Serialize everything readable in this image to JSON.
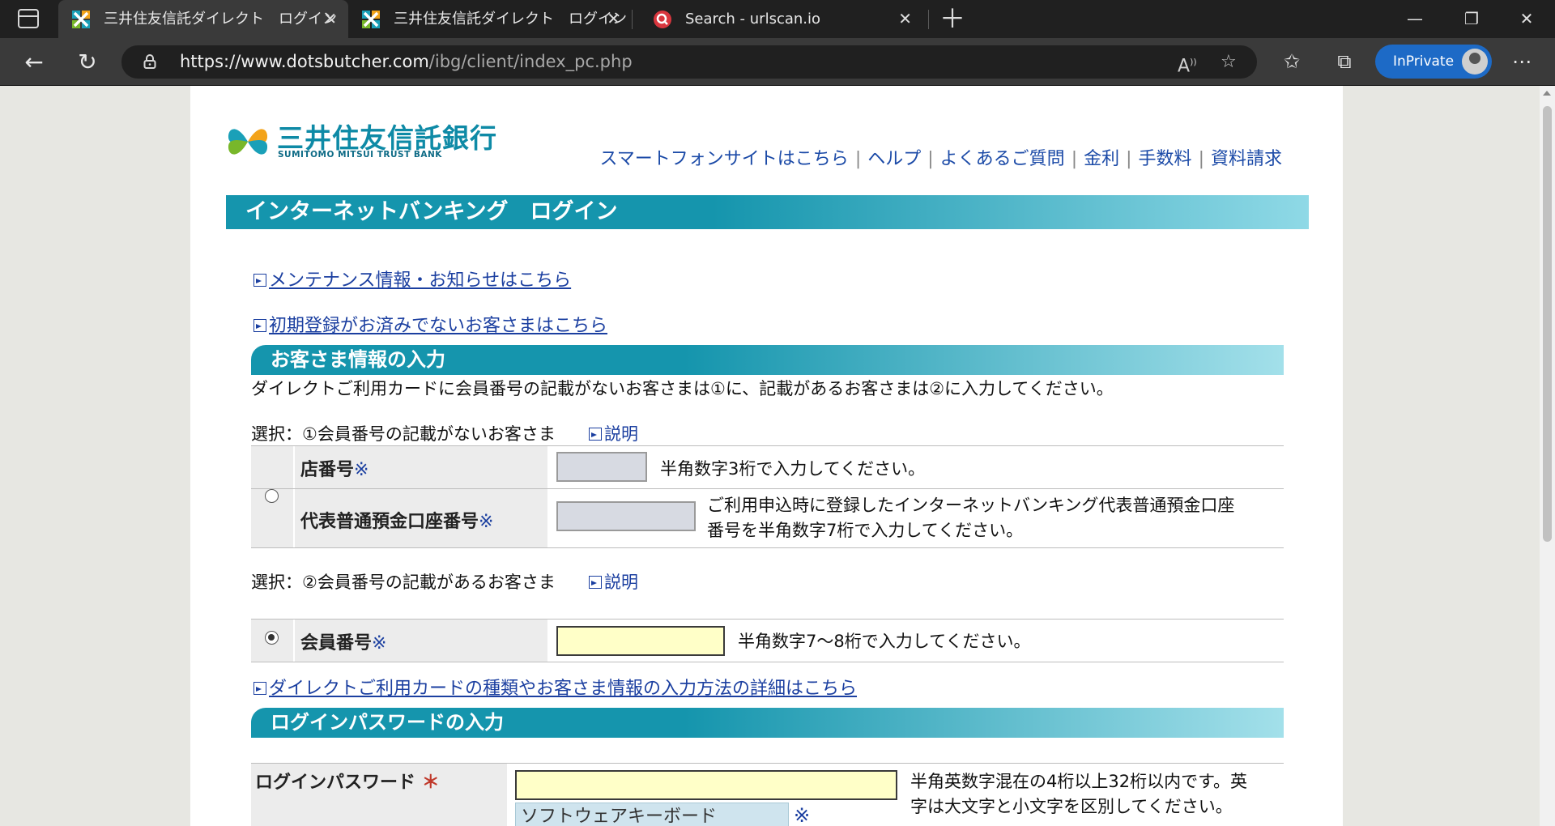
{
  "browser": {
    "tabs": [
      {
        "title": "三井住友信託ダイレクト　ログイン",
        "active": true
      },
      {
        "title": "三井住友信託ダイレクト　ログイン",
        "active": false
      },
      {
        "title": "Search - urlscan.io",
        "active": false
      }
    ],
    "url_host": "https://www.dotsbutcher.com",
    "url_path": "/ibg/client/index_pc.php",
    "inprivate_label": "InPrivate"
  },
  "header": {
    "logo_jp": "三井住友信託銀行",
    "logo_en": "SUMITOMO MITSUI TRUST BANK",
    "links": [
      "スマートフォンサイトはこちら",
      "ヘルプ",
      "よくあるご質問",
      "金利",
      "手数料",
      "資料請求"
    ]
  },
  "page_title": "インターネットバンキング　ログイン",
  "notices": {
    "maintenance": "メンテナンス情報・お知らせはこちら",
    "first_registration": "初期登録がお済みでないお客さまはこちら"
  },
  "customer_info": {
    "section_title": "お客さま情報の入力",
    "instruction": "ダイレクトご利用カードに会員番号の記載がないお客さまは①に、記載があるお客さまは②に入力してください。",
    "option1": {
      "label": "選択：①会員番号の記載がないお客さま",
      "help": "説明",
      "branch_label": "店番号",
      "branch_hint": "半角数字3桁で入力してください。",
      "account_label": "代表普通預金口座番号",
      "account_hint_1": "ご利用申込時に登録したインターネットバンキング代表普通預金口座",
      "account_hint_2": "番号を半角数字7桁で入力してください。"
    },
    "option2": {
      "label": "選択：②会員番号の記載があるお客さま",
      "help": "説明",
      "member_label": "会員番号",
      "member_hint": "半角数字7～8桁で入力してください。"
    },
    "required_mark": "※",
    "details_link": "ダイレクトご利用カードの種類やお客さま情報の入力方法の詳細はこちら"
  },
  "password": {
    "section_title": "ログインパスワードの入力",
    "label": "ログインパスワード",
    "required_mark": "＊",
    "hint_1": "半角英数字混在の4桁以上32桁以内です。英",
    "hint_2": "字は大文字と小文字を区別してください。",
    "keyboard_label": "ソフトウェアキーボード",
    "keyboard_note": "※"
  }
}
